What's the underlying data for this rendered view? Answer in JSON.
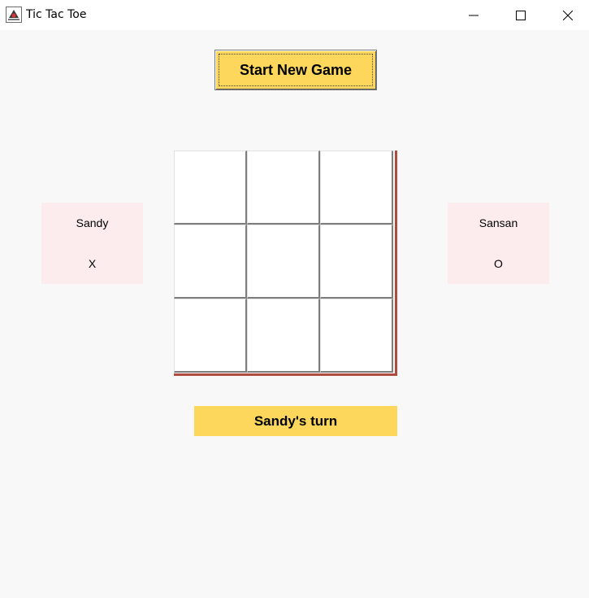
{
  "window": {
    "title": "Tic Tac Toe",
    "app_icon": "java-duke-icon",
    "controls": [
      "minimize",
      "maximize",
      "close"
    ]
  },
  "start_button": {
    "label": "Start New Game"
  },
  "players": [
    {
      "name": "Sandy",
      "mark": "X"
    },
    {
      "name": "Sansan",
      "mark": "O"
    }
  ],
  "board": {
    "cells": [
      "",
      "",
      "",
      "",
      "",
      "",
      "",
      "",
      ""
    ]
  },
  "status": {
    "turn_text": "Sandy's turn"
  },
  "colors": {
    "background": "#f8f8f8",
    "button_yellow": "#fcd75b",
    "player_panel": "#fdecee",
    "board_accent": "#b04b40"
  }
}
